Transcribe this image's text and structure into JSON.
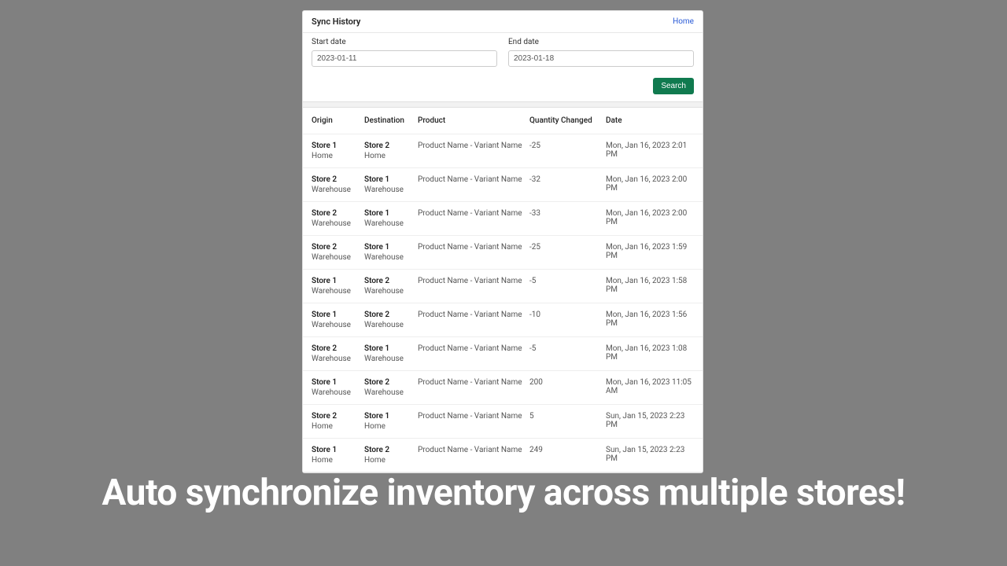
{
  "header": {
    "title": "Sync History",
    "home": "Home"
  },
  "filters": {
    "start_label": "Start date",
    "start_value": "2023-01-11",
    "end_label": "End date",
    "end_value": "2023-01-18",
    "search": "Search"
  },
  "columns": {
    "origin": "Origin",
    "destination": "Destination",
    "product": "Product",
    "qty": "Quantity Changed",
    "date": "Date"
  },
  "rows": [
    {
      "o_store": "Store 1",
      "o_loc": "Home",
      "d_store": "Store 2",
      "d_loc": "Home",
      "product": "Product Name - Variant Name",
      "qty": "-25",
      "date": "Mon, Jan 16, 2023 2:01 PM"
    },
    {
      "o_store": "Store 2",
      "o_loc": "Warehouse",
      "d_store": "Store 1",
      "d_loc": "Warehouse",
      "product": "Product Name - Variant Name",
      "qty": "-32",
      "date": "Mon, Jan 16, 2023 2:00 PM"
    },
    {
      "o_store": "Store 2",
      "o_loc": "Warehouse",
      "d_store": "Store 1",
      "d_loc": "Warehouse",
      "product": "Product Name - Variant Name",
      "qty": "-33",
      "date": "Mon, Jan 16, 2023 2:00 PM"
    },
    {
      "o_store": "Store 2",
      "o_loc": "Warehouse",
      "d_store": "Store 1",
      "d_loc": "Warehouse",
      "product": "Product Name - Variant Name",
      "qty": "-25",
      "date": "Mon, Jan 16, 2023 1:59 PM"
    },
    {
      "o_store": "Store 1",
      "o_loc": "Warehouse",
      "d_store": "Store 2",
      "d_loc": "Warehouse",
      "product": "Product Name - Variant Name",
      "qty": "-5",
      "date": "Mon, Jan 16, 2023 1:58 PM"
    },
    {
      "o_store": "Store 1",
      "o_loc": "Warehouse",
      "d_store": "Store 2",
      "d_loc": "Warehouse",
      "product": "Product Name - Variant Name",
      "qty": "-10",
      "date": "Mon, Jan 16, 2023 1:56 PM"
    },
    {
      "o_store": "Store 2",
      "o_loc": "Warehouse",
      "d_store": "Store 1",
      "d_loc": "Warehouse",
      "product": "Product Name - Variant Name",
      "qty": "-5",
      "date": "Mon, Jan 16, 2023 1:08 PM"
    },
    {
      "o_store": "Store 1",
      "o_loc": "Warehouse",
      "d_store": "Store 2",
      "d_loc": "Warehouse",
      "product": "Product Name - Variant Name",
      "qty": "200",
      "date": "Mon, Jan 16, 2023 11:05 AM"
    },
    {
      "o_store": "Store 2",
      "o_loc": "Home",
      "d_store": "Store 1",
      "d_loc": "Home",
      "product": "Product Name - Variant Name",
      "qty": "5",
      "date": "Sun, Jan 15, 2023 2:23 PM"
    },
    {
      "o_store": "Store 1",
      "o_loc": "Home",
      "d_store": "Store 2",
      "d_loc": "Home",
      "product": "Product Name - Variant Name",
      "qty": "249",
      "date": "Sun, Jan 15, 2023 2:23 PM"
    }
  ],
  "tagline": "Auto synchronize inventory across multiple stores!"
}
